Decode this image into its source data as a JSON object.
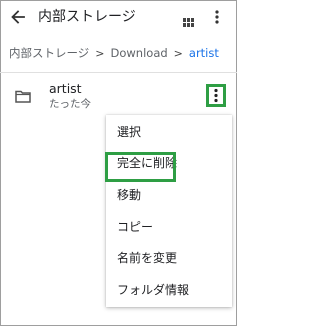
{
  "header": {
    "back_icon": "arrow-left-icon",
    "title": "内部ストレージ",
    "grid_icon": "grid-view-icon",
    "more_icon": "more-vert-icon"
  },
  "breadcrumb": {
    "items": [
      "内部ストレージ",
      "Download",
      "artist"
    ],
    "separator": ">"
  },
  "list": {
    "items": [
      {
        "icon": "folder-icon",
        "name": "artist",
        "subtitle": "たった今"
      }
    ]
  },
  "context_menu": {
    "items": [
      "選択",
      "完全に削除",
      "移動",
      "コピー",
      "名前を変更",
      "フォルダ情報"
    ],
    "highlighted": "移動"
  },
  "colors": {
    "highlight": "#2e9e44",
    "breadcrumb_current": "#1a73e8"
  }
}
